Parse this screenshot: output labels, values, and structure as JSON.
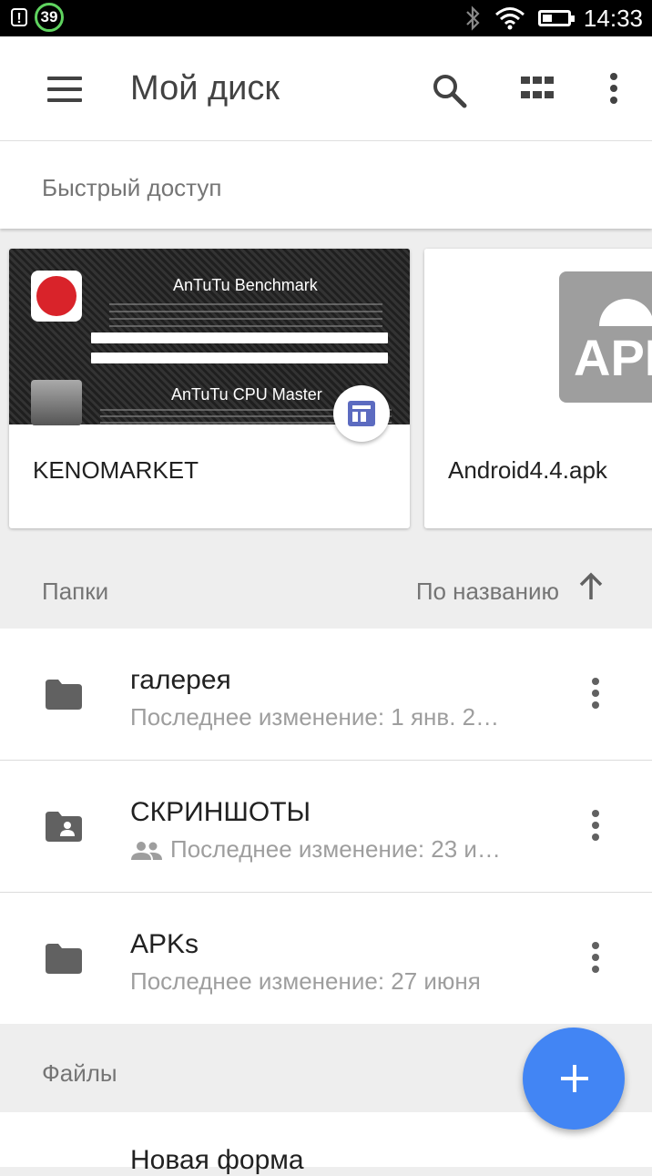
{
  "status_bar": {
    "notification_count": "39",
    "time": "14:33"
  },
  "app_bar": {
    "title": "Мой диск"
  },
  "quick_access": {
    "label": "Быстрый доступ",
    "cards": [
      {
        "name": "KENOMARKET",
        "thumb_title_1": "AnTuTu Benchmark",
        "thumb_title_2": "AnTuTu CPU Master"
      },
      {
        "name": "Android4.4.apk",
        "thumb_label": "APK"
      }
    ]
  },
  "folders": {
    "label": "Папки",
    "sort_label": "По названию",
    "items": [
      {
        "title": "галерея",
        "subtitle": "Последнее изменение: 1 янв. 2…",
        "shared": false
      },
      {
        "title": "СКРИНШОТЫ",
        "subtitle": "Последнее изменение: 23 и…",
        "shared": true
      },
      {
        "title": "APKs",
        "subtitle": "Последнее изменение: 27 июня",
        "shared": false
      }
    ]
  },
  "files": {
    "label": "Файлы",
    "first_item": "Новая форма"
  },
  "colors": {
    "fab": "#4285f4",
    "form_icon": "#5c6bc0",
    "antutu_red": "#d9232a"
  }
}
